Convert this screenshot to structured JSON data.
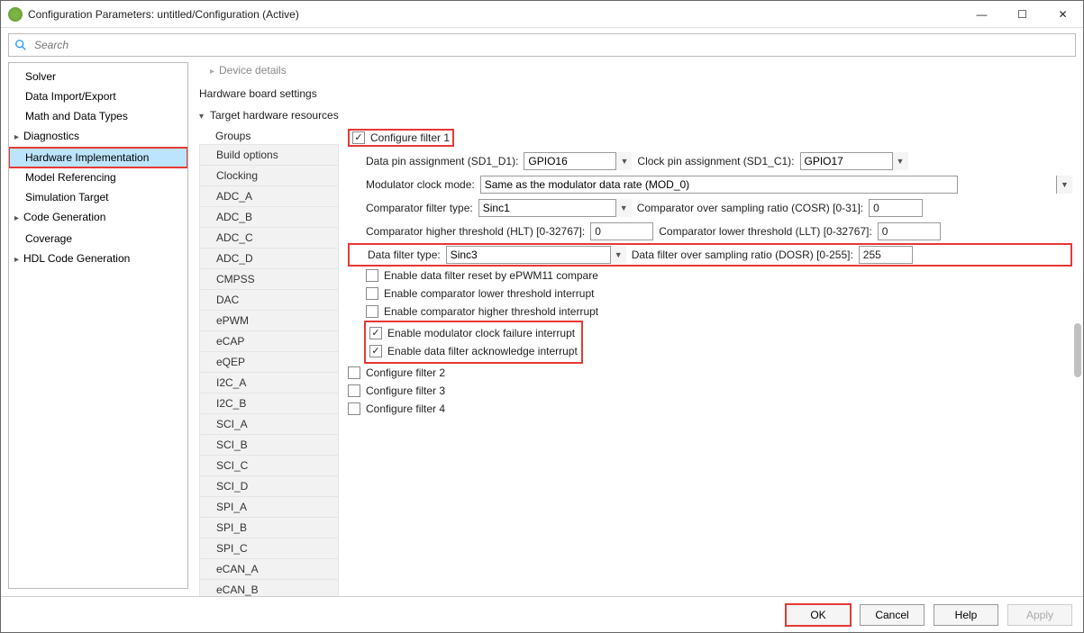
{
  "window": {
    "title": "Configuration Parameters: untitled/Configuration (Active)"
  },
  "search": {
    "placeholder": "Search"
  },
  "nav": {
    "items": [
      {
        "label": "Solver",
        "expandable": false
      },
      {
        "label": "Data Import/Export",
        "expandable": false
      },
      {
        "label": "Math and Data Types",
        "expandable": false
      },
      {
        "label": "Diagnostics",
        "expandable": true
      },
      {
        "label": "Hardware Implementation",
        "expandable": false,
        "selected": true,
        "highlighted": true
      },
      {
        "label": "Model Referencing",
        "expandable": false
      },
      {
        "label": "Simulation Target",
        "expandable": false
      },
      {
        "label": "Code Generation",
        "expandable": true
      },
      {
        "label": "Coverage",
        "expandable": false
      },
      {
        "label": "HDL Code Generation",
        "expandable": true
      }
    ]
  },
  "main": {
    "dim_section": "Device details",
    "section": "Hardware board settings",
    "expander": "Target hardware resources",
    "groups_title": "Groups",
    "groups": [
      "Build options",
      "Clocking",
      "ADC_A",
      "ADC_B",
      "ADC_C",
      "ADC_D",
      "CMPSS",
      "DAC",
      "ePWM",
      "eCAP",
      "eQEP",
      "I2C_A",
      "I2C_B",
      "SCI_A",
      "SCI_B",
      "SCI_C",
      "SCI_D",
      "SPI_A",
      "SPI_B",
      "SPI_C",
      "eCAN_A",
      "eCAN_B"
    ]
  },
  "form": {
    "configure_filter1": {
      "label": "Configure filter 1",
      "checked": true
    },
    "data_pin_label": "Data pin assignment (SD1_D1):",
    "data_pin_value": "GPIO16",
    "clock_pin_label": "Clock pin assignment (SD1_C1):",
    "clock_pin_value": "GPIO17",
    "mod_mode_label": "Modulator clock mode:",
    "mod_mode_value": "Same as the modulator data rate (MOD_0)",
    "comp_filter_label": "Comparator filter type:",
    "comp_filter_value": "Sinc1",
    "cosr_label": "Comparator over sampling ratio (COSR) [0-31]:",
    "cosr_value": "0",
    "hlt_label": "Comparator higher threshold (HLT) [0-32767]:",
    "hlt_value": "0",
    "llt_label": "Comparator lower threshold (LLT) [0-32767]:",
    "llt_value": "0",
    "data_filter_label": "Data filter type:",
    "data_filter_value": "Sinc3",
    "dosr_label": "Data filter over sampling ratio (DOSR) [0-255]:",
    "dosr_value": "255",
    "cb_reset": {
      "label": "Enable data filter reset by ePWM11 compare",
      "checked": false
    },
    "cb_low_int": {
      "label": "Enable comparator lower threshold interrupt",
      "checked": false
    },
    "cb_high_int": {
      "label": "Enable comparator higher threshold interrupt",
      "checked": false
    },
    "cb_mod_fail": {
      "label": "Enable modulator clock failure interrupt",
      "checked": true
    },
    "cb_ack_int": {
      "label": "Enable data filter acknowledge interrupt",
      "checked": true
    },
    "filter2": {
      "label": "Configure filter 2",
      "checked": false
    },
    "filter3": {
      "label": "Configure filter 3",
      "checked": false
    },
    "filter4": {
      "label": "Configure filter 4",
      "checked": false
    }
  },
  "footer": {
    "ok": "OK",
    "cancel": "Cancel",
    "help": "Help",
    "apply": "Apply"
  }
}
